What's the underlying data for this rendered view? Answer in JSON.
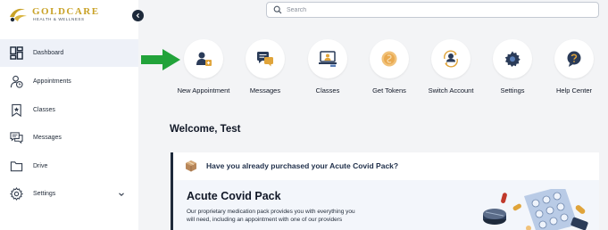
{
  "brand": {
    "name": "GOLDCARE",
    "tagline": "HEALTH & WELLNESS"
  },
  "search": {
    "placeholder": "Search"
  },
  "sidebar": {
    "items": [
      {
        "label": "Dashboard",
        "icon": "dashboard-icon",
        "active": true
      },
      {
        "label": "Appointments",
        "icon": "person-clock-icon"
      },
      {
        "label": "Classes",
        "icon": "bookmark-icon"
      },
      {
        "label": "Messages",
        "icon": "chat-bubbles-icon"
      },
      {
        "label": "Drive",
        "icon": "folder-icon"
      },
      {
        "label": "Settings",
        "icon": "gear-icon",
        "expandable": true
      }
    ]
  },
  "quick_actions": [
    {
      "label": "New Appointment",
      "icon": "new-appointment-icon"
    },
    {
      "label": "Messages",
      "icon": "messages-icon"
    },
    {
      "label": "Classes",
      "icon": "classes-icon"
    },
    {
      "label": "Get Tokens",
      "icon": "tokens-icon"
    },
    {
      "label": "Switch Account",
      "icon": "switch-account-icon"
    },
    {
      "label": "Settings",
      "icon": "settings-icon"
    },
    {
      "label": "Help Center",
      "icon": "help-icon"
    }
  ],
  "welcome": "Welcome, Test",
  "promo": {
    "question": "Have you already purchased your Acute Covid Pack?",
    "title": "Acute Covid Pack",
    "description": "Our proprietary medication pack provides you with everything you will need, including an appointment with one of our providers"
  },
  "colors": {
    "accent_navy": "#1e2a3b",
    "brand_gold": "#c9a227",
    "arrow_green": "#22a33a",
    "background": "#f3f4f6"
  }
}
